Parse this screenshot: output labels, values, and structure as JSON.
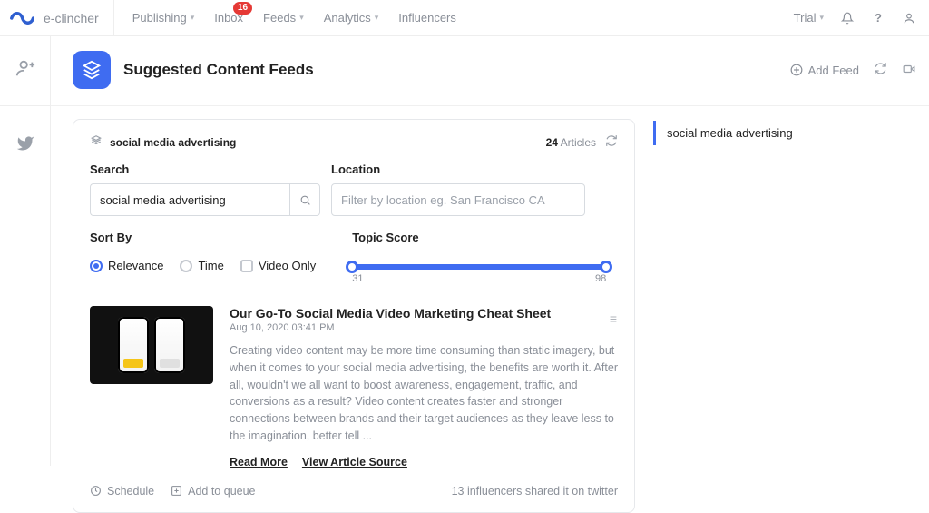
{
  "header": {
    "brand": "e-clincher",
    "nav": {
      "publishing": "Publishing",
      "inbox": "Inbox",
      "inbox_badge": "16",
      "feeds": "Feeds",
      "analytics": "Analytics",
      "influencers": "Influencers"
    },
    "right": {
      "trial": "Trial"
    }
  },
  "page": {
    "title": "Suggested Content Feeds",
    "add_feed": "Add Feed"
  },
  "card": {
    "feed_name": "social media advertising",
    "count": "24",
    "count_label": "Articles",
    "search_label": "Search",
    "search_value": "social media advertising",
    "location_label": "Location",
    "location_placeholder": "Filter by location eg. San Francisco CA",
    "sort_label": "Sort By",
    "sort_options": {
      "relevance": "Relevance",
      "time": "Time",
      "video_only": "Video Only"
    },
    "score_label": "Topic Score",
    "score_min": "31",
    "score_max": "98"
  },
  "article": {
    "title": "Our Go-To Social Media Video Marketing Cheat Sheet",
    "date": "Aug 10, 2020 03:41 PM",
    "excerpt": "Creating video content may be more time consuming than static imagery, but when it comes to your social media advertising, the benefits are worth it. After all, wouldn't we all want to boost awareness, engagement, traffic, and conversions as a result? Video content creates faster and stronger connections between brands and their target audiences as they leave less to the imagination, better tell ...",
    "read_more": "Read More",
    "view_source": "View Article Source",
    "schedule": "Schedule",
    "add_queue": "Add to queue",
    "shared": "13 influencers shared it on twitter"
  },
  "right_panel": {
    "active_feed": "social media advertising"
  }
}
